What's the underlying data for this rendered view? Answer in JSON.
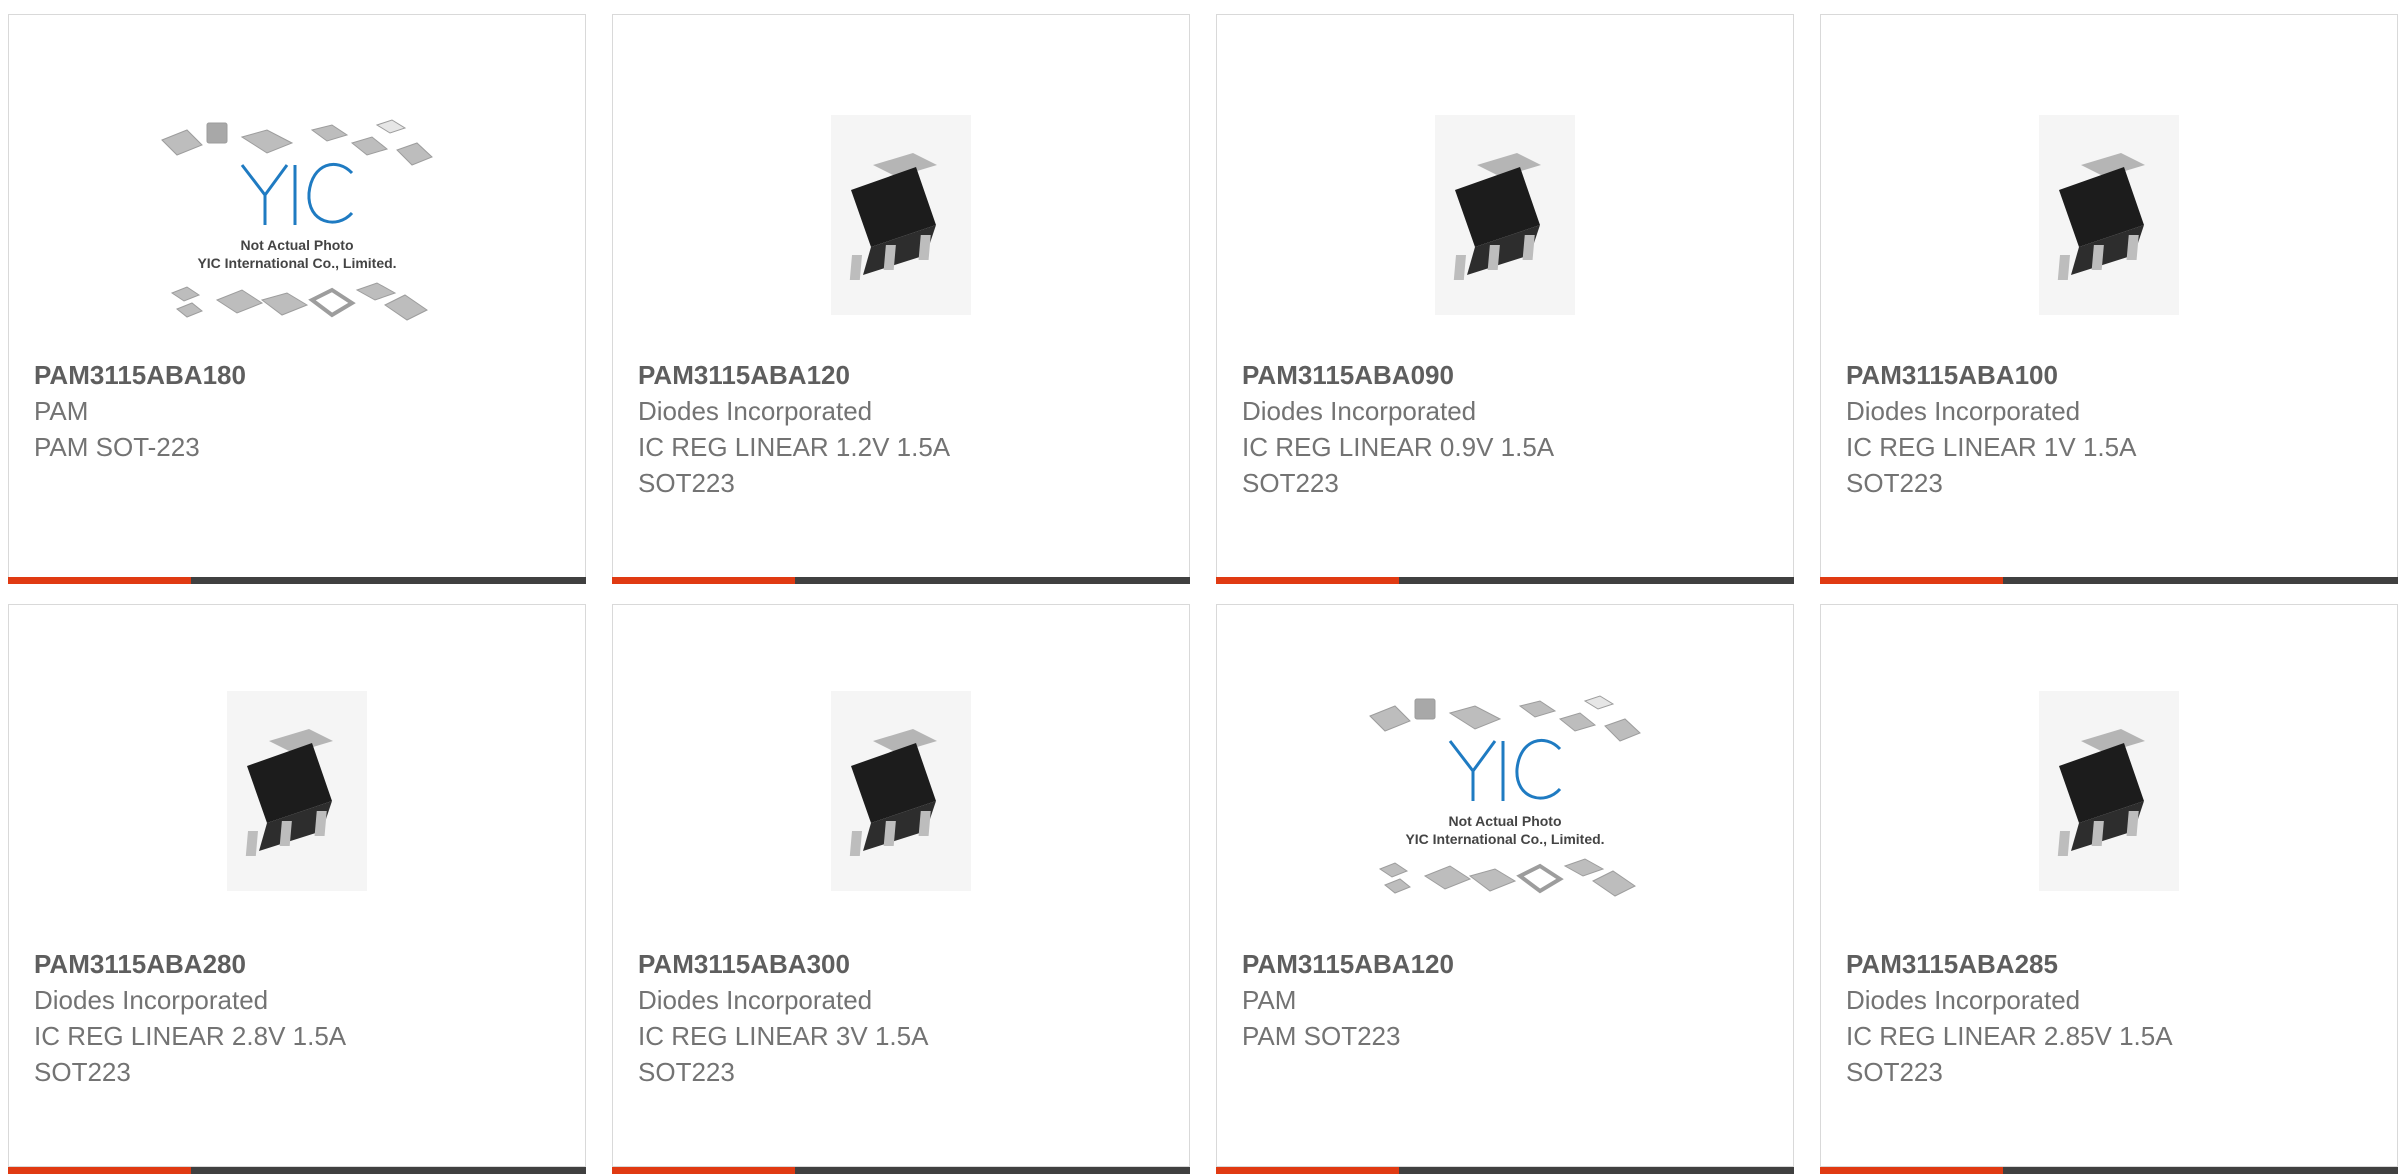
{
  "colors": {
    "accent": "#e03a12",
    "bar": "#404040",
    "text": "#737373"
  },
  "products": [
    {
      "part": "PAM3115ABA180",
      "manufacturer": "PAM",
      "desc1": "PAM SOT-223",
      "desc2": "",
      "image": "yic-placeholder-image",
      "image_text": [
        "Not Actual Photo",
        "YIC International Co., Limited."
      ]
    },
    {
      "part": "PAM3115ABA120",
      "manufacturer": "Diodes Incorporated",
      "desc1": "IC REG LINEAR 1.2V 1.5A",
      "desc2": "SOT223",
      "image": "sot223-chip-image"
    },
    {
      "part": "PAM3115ABA090",
      "manufacturer": "Diodes Incorporated",
      "desc1": "IC REG LINEAR 0.9V 1.5A",
      "desc2": "SOT223",
      "image": "sot223-chip-image"
    },
    {
      "part": "PAM3115ABA100",
      "manufacturer": "Diodes Incorporated",
      "desc1": "IC REG LINEAR 1V 1.5A",
      "desc2": "SOT223",
      "image": "sot223-chip-image"
    },
    {
      "part": "PAM3115ABA280",
      "manufacturer": "Diodes Incorporated",
      "desc1": "IC REG LINEAR 2.8V 1.5A",
      "desc2": "SOT223",
      "image": "sot223-chip-image"
    },
    {
      "part": "PAM3115ABA300",
      "manufacturer": "Diodes Incorporated",
      "desc1": "IC REG LINEAR 3V 1.5A",
      "desc2": "SOT223",
      "image": "sot223-chip-image"
    },
    {
      "part": "PAM3115ABA120",
      "manufacturer": "PAM",
      "desc1": "PAM SOT223",
      "desc2": "",
      "image": "yic-placeholder-image",
      "image_text": [
        "Not Actual Photo",
        "YIC International Co., Limited."
      ]
    },
    {
      "part": "PAM3115ABA285",
      "manufacturer": "Diodes Incorporated",
      "desc1": "IC REG LINEAR 2.85V 1.5A",
      "desc2": "SOT223",
      "image": "sot223-chip-image"
    }
  ]
}
